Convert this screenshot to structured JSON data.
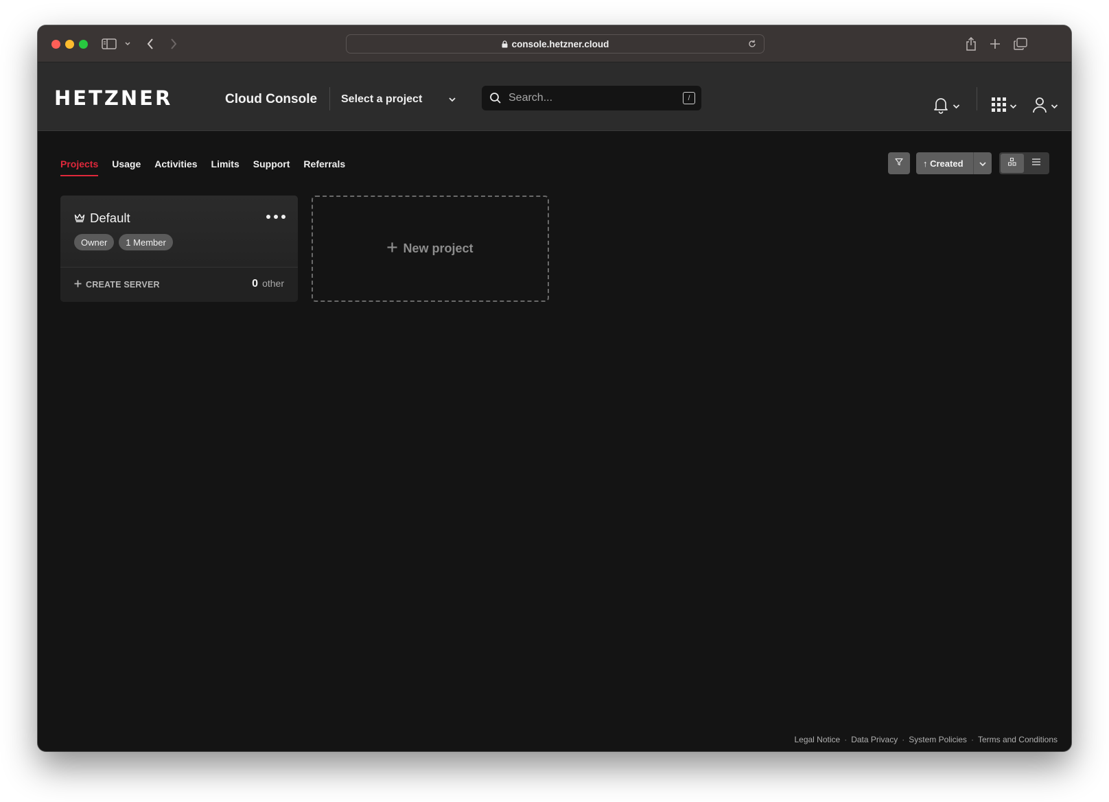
{
  "browser": {
    "url": "console.hetzner.cloud"
  },
  "header": {
    "logo": "HETZNER",
    "app_title": "Cloud Console",
    "project_select": "Select a project",
    "search_placeholder": "Search...",
    "search_shortcut": "/"
  },
  "tabs": [
    {
      "label": "Projects",
      "active": true
    },
    {
      "label": "Usage",
      "active": false
    },
    {
      "label": "Activities",
      "active": false
    },
    {
      "label": "Limits",
      "active": false
    },
    {
      "label": "Support",
      "active": false
    },
    {
      "label": "Referrals",
      "active": false
    }
  ],
  "toolbar": {
    "sort_label": "↑ Created",
    "view_mode": "grid"
  },
  "project_card": {
    "name": "Default",
    "badges": [
      "Owner",
      "1 Member"
    ],
    "create_server": "CREATE SERVER",
    "server_count": "0",
    "server_count_label": "other"
  },
  "new_project": {
    "label": "New project"
  },
  "footer": {
    "links": [
      "Legal Notice",
      "Data Privacy",
      "System Policies",
      "Terms and Conditions"
    ],
    "separator": "·"
  },
  "colors": {
    "accent": "#e0283b",
    "background": "#141414",
    "header": "#2c2c2c"
  }
}
